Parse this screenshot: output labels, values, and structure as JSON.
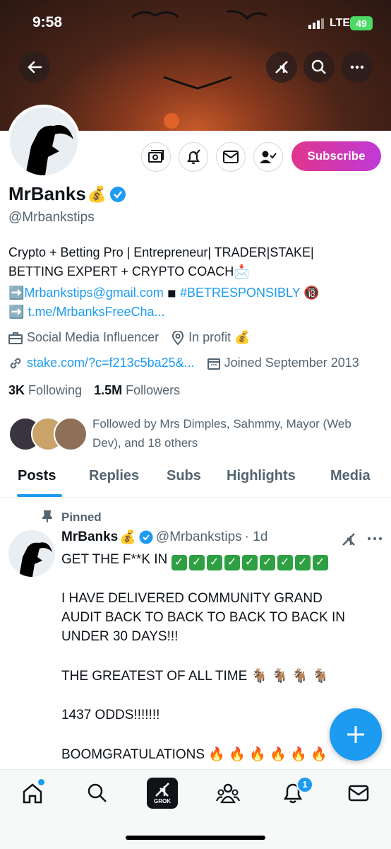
{
  "status_bar": {
    "time": "9:58",
    "network": "LTE",
    "battery": "49"
  },
  "profile": {
    "name": "MrBanks",
    "name_emoji": "💰",
    "handle": "@Mrbankstips",
    "subscribe_label": "Subscribe",
    "bio_line1": "Crypto + Betting Pro | Entrepreneur| TRADER|STAKE|",
    "bio_line2": "BETTING EXPERT + CRYPTO COACH📩",
    "bio_email_prefix": "➡️",
    "bio_email": "Mrbankstips@gmail.com",
    "bio_square": "◾",
    "bio_hashtag": "#BETRESPONSIBLY",
    "bio_no18": "🔞",
    "bio_link_prefix": "➡️",
    "bio_link": "t.me/MrbanksFreeCha...",
    "category": "Social Media Influencer",
    "location": "In profit 💰",
    "website": "stake.com/?c=f213c5ba25&...",
    "joined": "Joined September 2013",
    "following_count": "3K",
    "following_label": "Following",
    "followers_count": "1.5M",
    "followers_label": "Followers",
    "followed_by_line1": "Followed by Mrs Dimples, Sahmmy, Mayor (Web",
    "followed_by_line2": "Dev), and 18 others"
  },
  "tabs": [
    "Posts",
    "Replies",
    "Subs",
    "Highlights",
    "Media"
  ],
  "pinned_tweet": {
    "pinned_label": "Pinned",
    "author": "MrBanks",
    "author_emoji": "💰",
    "handle": "@Mrbankstips",
    "time": "· 1d",
    "line1_text": "GET THE F**K IN",
    "line1_checks": "✓✓✓✓✓✓✓✓✓",
    "para2_line1": "I HAVE DELIVERED COMMUNITY GRAND",
    "para2_line2": "AUDIT BACK TO BACK TO BACK TO BACK IN",
    "para2_line3": "UNDER 30 DAYS!!!",
    "para3": "THE GREATEST OF ALL TIME 🐐 🐐 🐐 🐐",
    "para4": "1437 ODDS!!!!!!!",
    "para5": "BOOMGRATULATIONS 🔥 🔥 🔥 🔥 🔥 🔥"
  },
  "bottom_nav": {
    "notification_count": "1",
    "grok_label": "GROK"
  },
  "colors": {
    "accent": "#1d9bf0",
    "subscribe_start": "#e0358c",
    "subscribe_end": "#c03ad8"
  }
}
